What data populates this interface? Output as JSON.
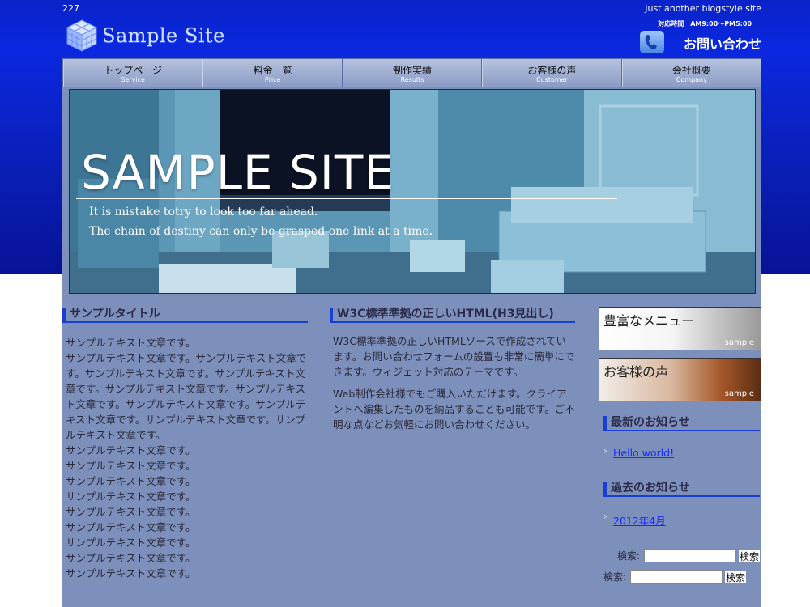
{
  "header": {
    "site_id": "227",
    "tagline": "Just another blogstyle site",
    "logo_text": "Sample Site",
    "contact_hours": "対応時間　AM9:00～PM5:00",
    "contact_label": "お問い合わせ"
  },
  "nav": [
    {
      "jp": "トップページ",
      "en": "Service"
    },
    {
      "jp": "料金一覧",
      "en": "Price"
    },
    {
      "jp": "制作実績",
      "en": "Results"
    },
    {
      "jp": "お客様の声",
      "en": "Customer"
    },
    {
      "jp": "会社概要",
      "en": "Company"
    }
  ],
  "hero": {
    "title": "SAMPLE SITE",
    "quote1": "It is mistake totry to look too far ahead.",
    "quote2": "The chain of destiny can only be grasped one link at a time."
  },
  "col1": {
    "title": "サンプルタイトル",
    "text": "サンプルテキスト文章です。\nサンプルテキスト文章です。サンプルテキスト文章です。サンプルテキスト文章です。サンプルテキスト文章です。サンプルテキスト文章です。サンプルテキスト文章です。サンプルテキスト文章です。サンプルテキスト文章です。サンプルテキスト文章です。サンプルテキスト文章です。\nサンプルテキスト文章です。\nサンプルテキスト文章です。\nサンプルテキスト文章です。\nサンプルテキスト文章です。\nサンプルテキスト文章です。\nサンプルテキスト文章です。\nサンプルテキスト文章です。\nサンプルテキスト文章です。\nサンプルテキスト文章です。"
  },
  "col2": {
    "title": "W3C標準準拠の正しいHTML(H3見出し)",
    "p1": "W3C標準準拠の正しいHTMLソースで作成されています。お問い合わせフォームの設置も非常に簡単にできます。ウィジェット対応のテーマです。",
    "p2": "Web制作会社様でもご購入いただけます。クライアントへ編集したものを納品することも可能です。ご不明な点などお気軽にお問い合わせください。"
  },
  "sidebar": {
    "banner1_title": "豊富なメニュー",
    "banner2_title": "お客様の声",
    "banner_sample": "sample",
    "news_title": "最新のお知らせ",
    "news_link": "Hello world!",
    "archive_title": "過去のお知らせ",
    "archive_link": "2012年4月",
    "search_label": "検索:",
    "search_button": "検索"
  }
}
